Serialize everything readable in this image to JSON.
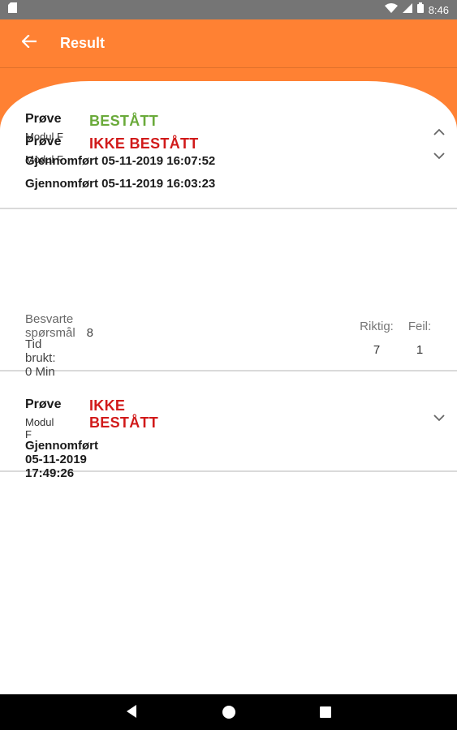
{
  "statusbar": {
    "time": "8:46",
    "icons": [
      "sd-card-icon",
      "wifi-icon",
      "signal-icon",
      "battery-icon"
    ]
  },
  "appbar": {
    "title": "Result",
    "back_icon": "arrow-left-icon",
    "color": "#ff8133"
  },
  "results": [
    {
      "title": "Prøve",
      "module": "Modul F",
      "status": "IKKE BESTÅTT",
      "status_type": "fail",
      "completed": "Gjennomført 05-11-2019 16:03:23",
      "expanded": false
    },
    {
      "title": "Prøve",
      "module": "Modul F",
      "status": "BESTÅTT",
      "status_type": "pass",
      "completed": "Gjennomført 05-11-2019 16:07:52",
      "expanded": true,
      "details": {
        "answered_label": "Besvarte spørsmål",
        "answered_value": "8",
        "time_used": "Tid brukt: 0 Min",
        "correct_label": "Riktig:",
        "correct_value": "7",
        "wrong_label": "Feil:",
        "wrong_value": "1"
      }
    },
    {
      "title": "Prøve",
      "module": "Modul F",
      "status": "IKKE BESTÅTT",
      "status_type": "fail",
      "completed": "Gjennomført 05-11-2019 17:49:26",
      "expanded": false
    }
  ],
  "colors": {
    "fail": "#d11a1a",
    "pass": "#6aaa3a"
  }
}
